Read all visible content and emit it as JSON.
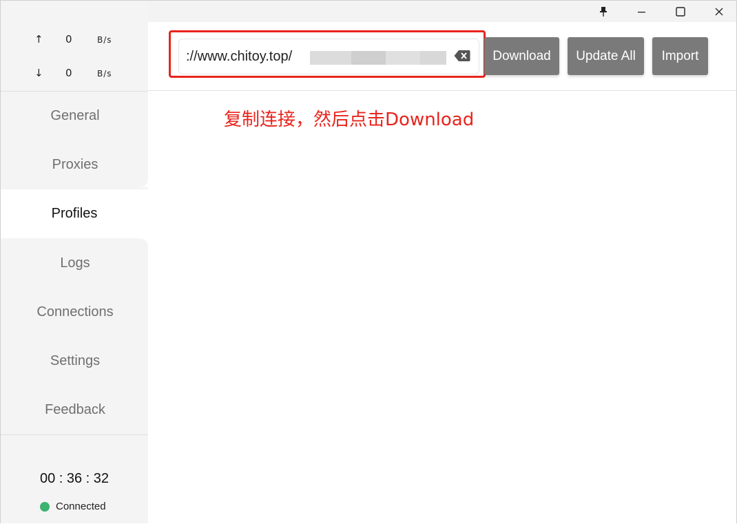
{
  "window": {
    "controls": {
      "pin_icon": "pin-icon",
      "minimize_icon": "minimize-icon",
      "maximize_icon": "maximize-icon",
      "close_icon": "close-icon"
    }
  },
  "traffic": {
    "upload": {
      "arrow": "↑",
      "value": "0",
      "unit": "B/s"
    },
    "download": {
      "arrow": "↓",
      "value": "0",
      "unit": "B/s"
    }
  },
  "sidebar": {
    "items": [
      {
        "label": "General",
        "active": false
      },
      {
        "label": "Proxies",
        "active": false
      },
      {
        "label": "Profiles",
        "active": true
      },
      {
        "label": "Logs",
        "active": false
      },
      {
        "label": "Connections",
        "active": false
      },
      {
        "label": "Settings",
        "active": false
      },
      {
        "label": "Feedback",
        "active": false
      }
    ]
  },
  "footer": {
    "timer": "00 : 36 : 32",
    "status": "Connected",
    "status_color": "#3cb371"
  },
  "toolbar": {
    "url_value": "://www.chitoy.top/",
    "download_label": "Download",
    "update_all_label": "Update All",
    "import_label": "Import",
    "button_color": "#7a7a7a"
  },
  "annotation": {
    "text": "复制连接，然后点击Download",
    "color": "#e8241c"
  }
}
